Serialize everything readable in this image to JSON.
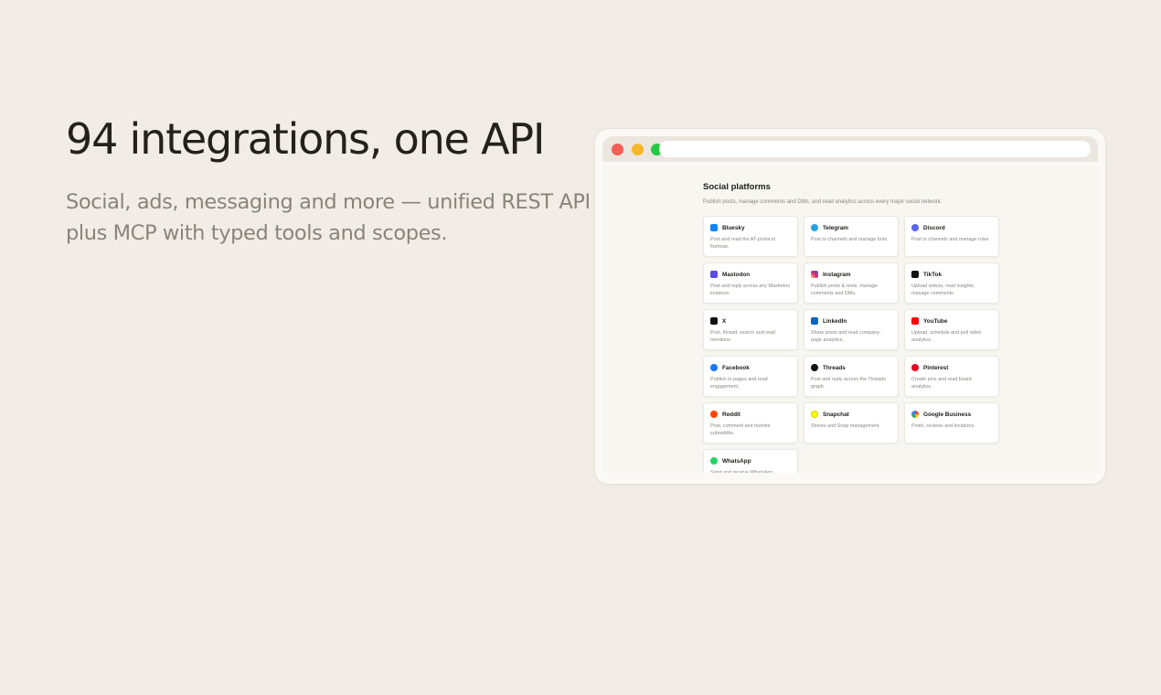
{
  "hero": {
    "title": "94 integrations, one API",
    "subtitle": "Social, ads, messaging and more — unified REST API plus MCP with typed tools and scopes."
  },
  "window": {
    "section_title": "Social platforms",
    "section_subtitle": "Publish posts, manage comments and DMs, and read analytics across every major social network.",
    "integrations": [
      {
        "name": "Bluesky",
        "description": "Post and read the AT-protocol firehose.",
        "icon": "bluesky-icon",
        "color": "#1185fe"
      },
      {
        "name": "Telegram",
        "description": "Post to channels and manage bots.",
        "icon": "telegram-icon",
        "color": "#27a2e0"
      },
      {
        "name": "Discord",
        "description": "Post to channels and manage roles.",
        "icon": "discord-icon",
        "color": "#5865f2"
      },
      {
        "name": "Mastodon",
        "description": "Post and reply across any Mastodon instance.",
        "icon": "mastodon-icon",
        "color": "#5b4be1"
      },
      {
        "name": "Instagram",
        "description": "Publish posts & reels, manage comments and DMs.",
        "icon": "instagram-icon",
        "color": "#d62976"
      },
      {
        "name": "TikTok",
        "description": "Upload videos, read insights, manage comments.",
        "icon": "tiktok-icon",
        "color": "#111111"
      },
      {
        "name": "X",
        "description": "Post, thread, search and read mentions.",
        "icon": "x-icon",
        "color": "#111111"
      },
      {
        "name": "LinkedIn",
        "description": "Share posts and read company-page analytics.",
        "icon": "linkedin-icon",
        "color": "#0a66c2"
      },
      {
        "name": "YouTube",
        "description": "Upload, schedule and pull video analytics.",
        "icon": "youtube-icon",
        "color": "#ff0000"
      },
      {
        "name": "Facebook",
        "description": "Publish to pages and read engagement.",
        "icon": "facebook-icon",
        "color": "#1877f2"
      },
      {
        "name": "Threads",
        "description": "Post and reply across the Threads graph.",
        "icon": "threads-icon",
        "color": "#111111"
      },
      {
        "name": "Pinterest",
        "description": "Create pins and read board analytics.",
        "icon": "pinterest-icon",
        "color": "#e60023"
      },
      {
        "name": "Reddit",
        "description": "Post, comment and monitor subreddits.",
        "icon": "reddit-icon",
        "color": "#ff4500"
      },
      {
        "name": "Snapchat",
        "description": "Stories and Snap management.",
        "icon": "snapchat-icon",
        "color": "#fffc00"
      },
      {
        "name": "Google Business",
        "description": "Posts, reviews and locations.",
        "icon": "google-icon",
        "color": "#4285f4"
      },
      {
        "name": "WhatsApp",
        "description": "Send and receive WhatsApp messages.",
        "icon": "whatsapp-icon",
        "color": "#25d366"
      }
    ]
  }
}
